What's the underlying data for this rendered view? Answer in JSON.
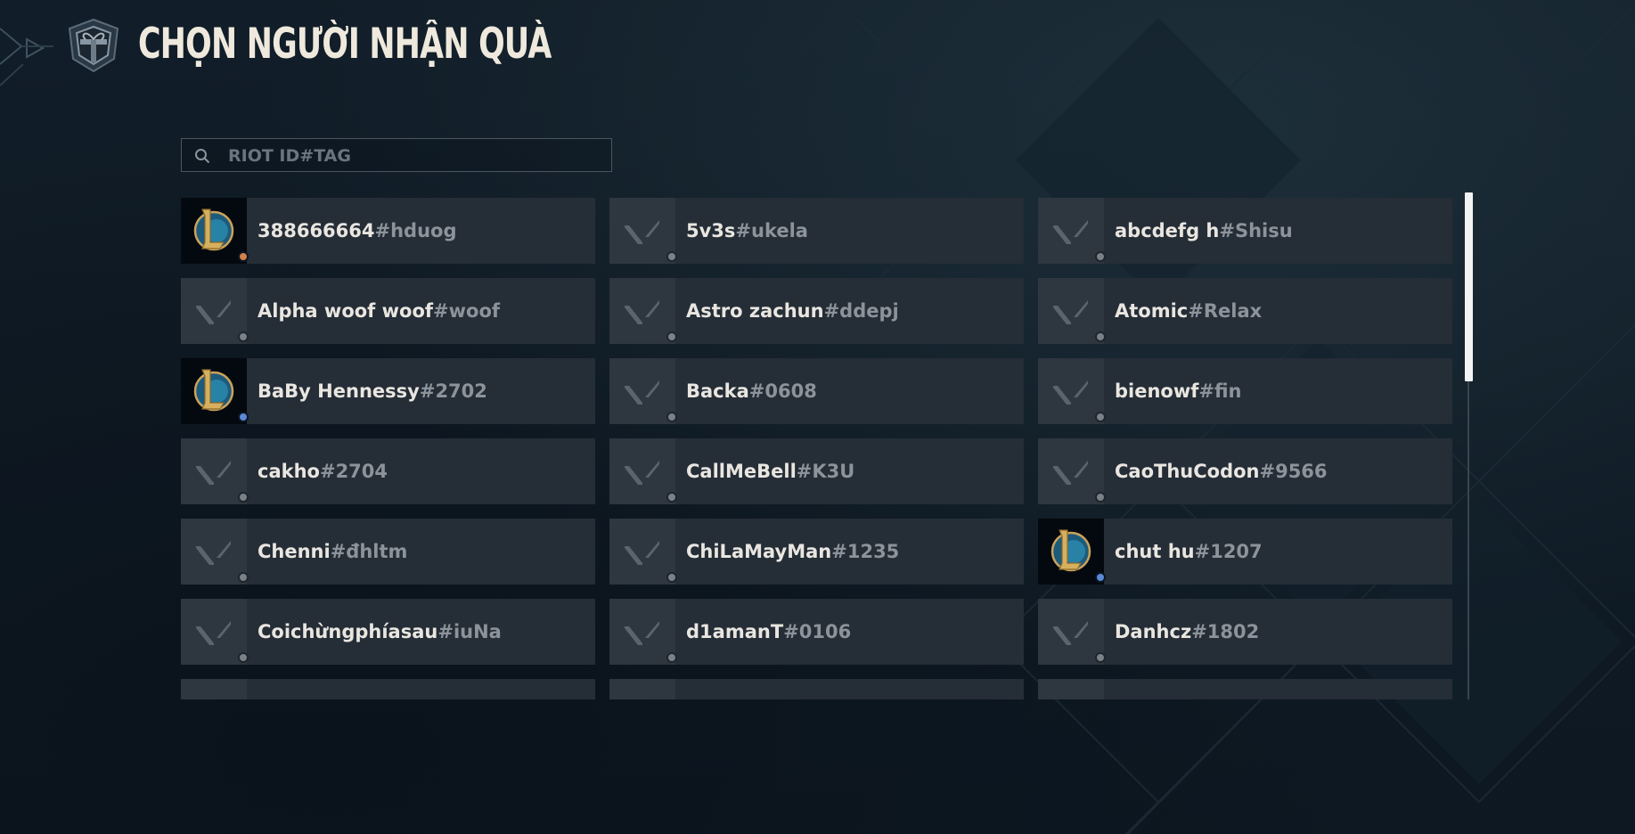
{
  "header": {
    "title": "CHỌN NGƯỜI NHẬN QUÀ",
    "back_icon": "chevron-left-icon",
    "brand_icon": "gift-shield-icon"
  },
  "search": {
    "placeholder": "RIOT ID#TAG",
    "value": "",
    "icon": "search-icon"
  },
  "colors": {
    "background": "#0f1a24",
    "card": "#252d37",
    "name": "#e9e6e0",
    "tag": "#8c939a",
    "status_offline": "#7a8288",
    "status_ingame": "#5a8ad6",
    "status_away": "#d2814a"
  },
  "friends": [
    {
      "name": "388666664",
      "tag": "#hduog",
      "avatar": "league-of-legends-icon",
      "status": "away"
    },
    {
      "name": "5v3s",
      "tag": "#ukela",
      "avatar": "valorant-icon",
      "status": "offline"
    },
    {
      "name": "abcdefg h",
      "tag": "#Shisu",
      "avatar": "valorant-icon",
      "status": "offline"
    },
    {
      "name": "Alpha woof woof",
      "tag": "#woof",
      "avatar": "valorant-icon",
      "status": "offline"
    },
    {
      "name": "Astro zachun",
      "tag": "#ddepj",
      "avatar": "valorant-icon",
      "status": "offline"
    },
    {
      "name": "Atomic",
      "tag": "#Relax",
      "avatar": "valorant-icon",
      "status": "offline"
    },
    {
      "name": "BaBy Hennessy",
      "tag": "#2702",
      "avatar": "league-of-legends-icon",
      "status": "ingame"
    },
    {
      "name": "Backa",
      "tag": "#0608",
      "avatar": "valorant-icon",
      "status": "offline"
    },
    {
      "name": "bienowf",
      "tag": "#fin",
      "avatar": "valorant-icon",
      "status": "offline"
    },
    {
      "name": "cakho",
      "tag": "#2704",
      "avatar": "valorant-icon",
      "status": "offline"
    },
    {
      "name": "CallMeBell",
      "tag": "#K3U",
      "avatar": "valorant-icon",
      "status": "offline"
    },
    {
      "name": "CaoThuCodon",
      "tag": "#9566",
      "avatar": "valorant-icon",
      "status": "offline"
    },
    {
      "name": "Chenni",
      "tag": "#đhltm",
      "avatar": "valorant-icon",
      "status": "offline"
    },
    {
      "name": "ChiLaMayMan",
      "tag": "#1235",
      "avatar": "valorant-icon",
      "status": "offline"
    },
    {
      "name": "chut hu",
      "tag": "#1207",
      "avatar": "league-of-legends-icon",
      "status": "ingame"
    },
    {
      "name": "Coichừngphíasau",
      "tag": "#iuNa",
      "avatar": "valorant-icon",
      "status": "offline"
    },
    {
      "name": "d1amanT",
      "tag": "#0106",
      "avatar": "valorant-icon",
      "status": "offline"
    },
    {
      "name": "Danhcz",
      "tag": "#1802",
      "avatar": "valorant-icon",
      "status": "offline"
    },
    {
      "name": "",
      "tag": "",
      "avatar": "valorant-icon",
      "status": "offline"
    },
    {
      "name": "",
      "tag": "",
      "avatar": "valorant-icon",
      "status": "offline"
    },
    {
      "name": "",
      "tag": "",
      "avatar": "valorant-icon",
      "status": "offline"
    }
  ]
}
